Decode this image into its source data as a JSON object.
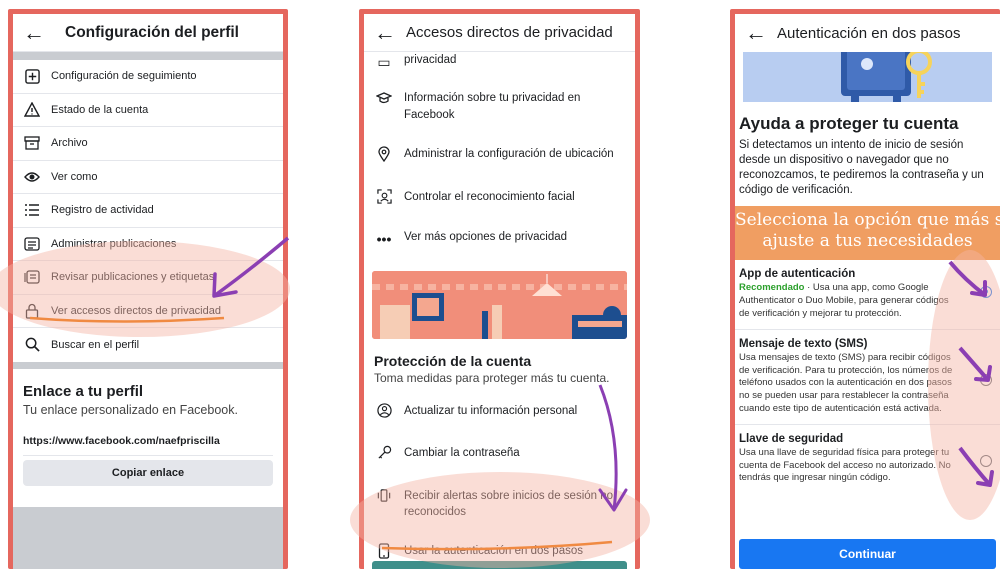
{
  "colors": {
    "frame": "#e5675e",
    "fb_blue": "#1877f2",
    "highlight": "#f3b3a5",
    "arrow": "#8b3fb3",
    "banner": "#f09e62"
  },
  "phone1": {
    "back_icon": "arrow-left-icon",
    "title": "Configuración del perfil",
    "items": [
      {
        "icon": "plus-box-icon",
        "label": "Configuración de seguimiento"
      },
      {
        "icon": "warning-icon",
        "label": "Estado de la cuenta"
      },
      {
        "icon": "archive-icon",
        "label": "Archivo"
      },
      {
        "icon": "eye-icon",
        "label": "Ver como"
      },
      {
        "icon": "list-icon",
        "label": "Registro de actividad"
      },
      {
        "icon": "document-icon",
        "label": "Administrar publicaciones"
      },
      {
        "icon": "review-icon",
        "label": "Revisar publicaciones y etiquetas"
      },
      {
        "icon": "lock-icon",
        "label": "Ver accesos directos de privacidad"
      },
      {
        "icon": "search-icon",
        "label": "Buscar en el perfil"
      }
    ],
    "link_section": {
      "title": "Enlace a tu perfil",
      "subtitle": "Tu enlace personalizado en Facebook.",
      "url": "https://www.facebook.com/naefpriscilla",
      "copy_button": "Copiar enlace"
    }
  },
  "phone2": {
    "title": "Accesos directos de privacidad",
    "items": [
      {
        "icon": "device-icon",
        "label": "privacidad"
      },
      {
        "icon": "graduation-cap-icon",
        "label": "Información sobre tu privacidad en Facebook"
      },
      {
        "icon": "location-pin-icon",
        "label": "Administrar la configuración de ubicación"
      },
      {
        "icon": "face-scan-icon",
        "label": "Controlar el reconocimiento facial"
      },
      {
        "icon": "more-dots-icon",
        "label": "Ver más opciones de privacidad"
      }
    ],
    "protection": {
      "title": "Protección de la cuenta",
      "subtitle": "Toma medidas para proteger más tu cuenta.",
      "items": [
        {
          "icon": "person-icon",
          "label": "Actualizar tu información personal"
        },
        {
          "icon": "key-icon",
          "label": "Cambiar la contraseña"
        },
        {
          "icon": "vibrate-icon",
          "label": "Recibir alertas sobre inicios de sesión no reconocidos"
        },
        {
          "icon": "phone-icon",
          "label": "Usar la autenticación en dos pasos"
        }
      ]
    }
  },
  "phone3": {
    "title": "Autenticación en dos pasos",
    "heading": "Ayuda a proteger tu cuenta",
    "body": "Si detectamos un intento de inicio de sesión desde un dispositivo o navegador que no reconozcamos, te pediremos la contraseña y un código de verificación.",
    "banner": [
      "Selecciona la opción que más se",
      "ajuste a tus necesidades"
    ],
    "options": [
      {
        "title": "App de autenticación",
        "recommended": "Recomendado",
        "desc": " · Usa una app, como Google Authenticator o Duo Mobile, para generar códigos de verificación y mejorar tu protección.",
        "selected": true
      },
      {
        "title": "Mensaje de texto (SMS)",
        "recommended": "",
        "desc": "Usa mensajes de texto (SMS) para recibir códigos de verificación. Para tu protección, los números de teléfono usados con la autenticación en dos pasos no se pueden usar para restablecer la contraseña cuando este tipo de autenticación está activada.",
        "selected": false
      },
      {
        "title": "Llave de seguridad",
        "recommended": "",
        "desc": "Usa una llave de seguridad física para proteger tu cuenta de Facebook del acceso no autorizado. No tendrás que ingresar ningún código.",
        "selected": false
      }
    ],
    "continue_button": "Continuar"
  }
}
